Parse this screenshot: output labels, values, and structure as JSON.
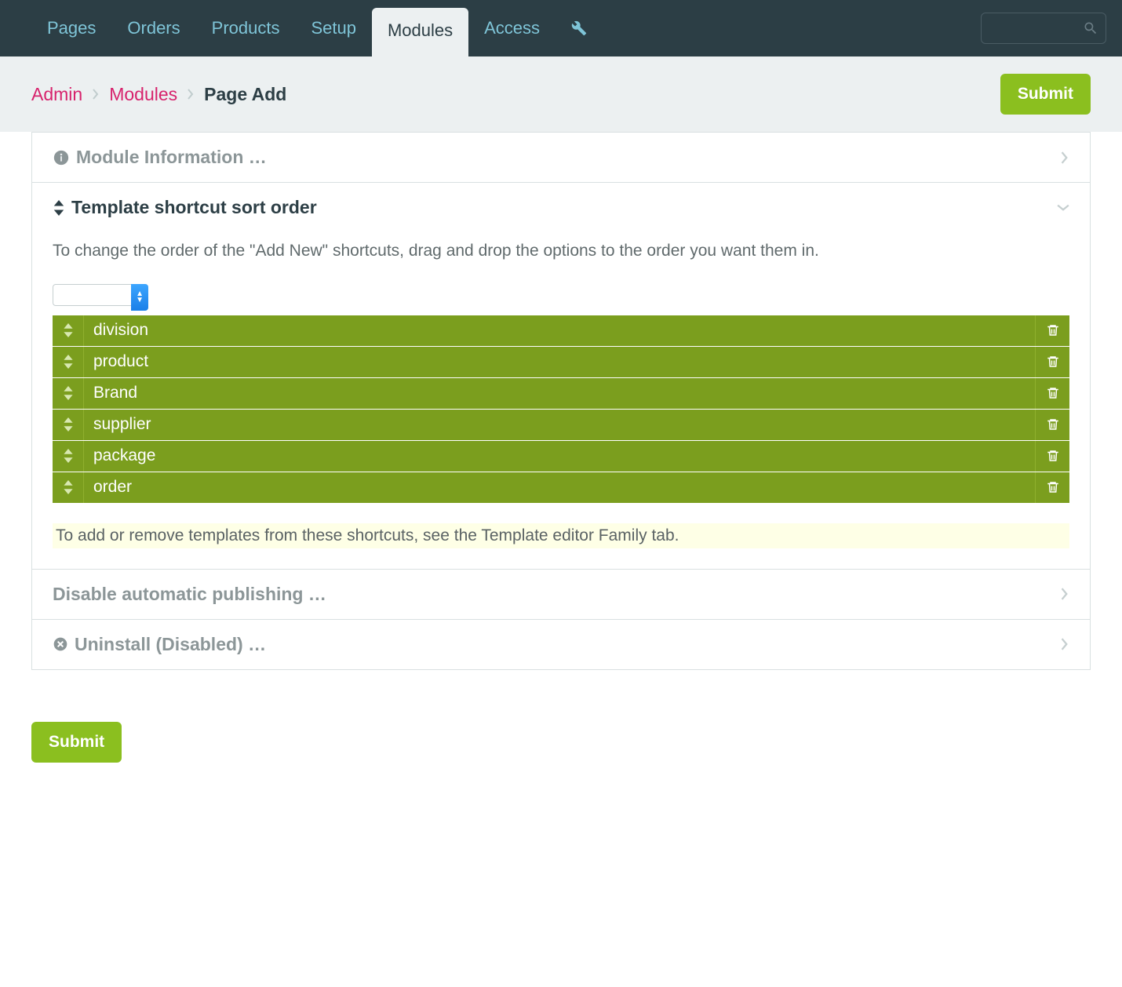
{
  "nav": {
    "tabs": [
      "Pages",
      "Orders",
      "Products",
      "Setup",
      "Modules",
      "Access"
    ],
    "active_index": 4
  },
  "breadcrumb": {
    "items": [
      "Admin",
      "Modules"
    ],
    "current": "Page Add"
  },
  "buttons": {
    "submit": "Submit"
  },
  "panels": {
    "module_info": {
      "title": "Module Information …"
    },
    "sort_order": {
      "title": "Template shortcut sort order",
      "desc": "To change the order of the \"Add New\" shortcuts, drag and drop the options to the order you want them in.",
      "items": [
        "division",
        "product",
        "Brand",
        "supplier",
        "package",
        "order"
      ],
      "note": "To add or remove templates from these shortcuts, see the Template editor Family tab."
    },
    "disable_pub": {
      "title": "Disable automatic publishing …"
    },
    "uninstall": {
      "title": "Uninstall (Disabled) …"
    }
  }
}
